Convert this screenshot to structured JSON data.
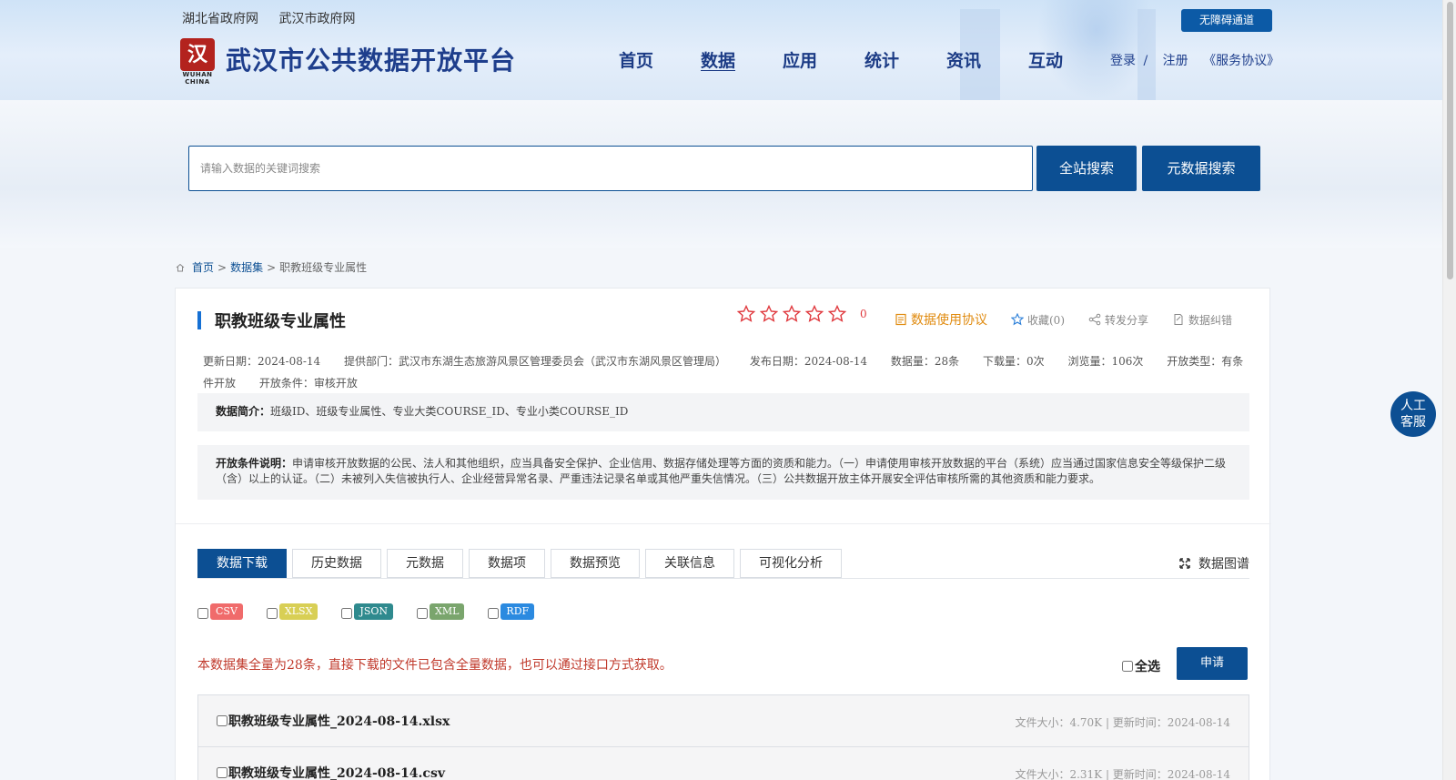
{
  "header": {
    "top_links": [
      "湖北省政府网",
      "武汉市政府网"
    ],
    "logo_text": "武汉市公共数据开放平台",
    "logo_seal": "汉",
    "logo_sub": "WUHAN CHINA",
    "nav": [
      "首页",
      "数据",
      "应用",
      "统计",
      "资讯",
      "互动"
    ],
    "nav_active_index": 1,
    "accessible_channel": "无障碍通道",
    "login": "登录",
    "login_sep": "/",
    "register": "注册",
    "service_agreement": "《服务协议》"
  },
  "search": {
    "placeholder": "请输入数据的关键词搜索",
    "site_search": "全站搜索",
    "metadata_search": "元数据搜索"
  },
  "breadcrumb": {
    "home": "首页",
    "sep": ">",
    "dataset": "数据集",
    "current": "职教班级专业属性"
  },
  "dataset": {
    "title": "职教班级专业属性",
    "rating_count": "0",
    "agreement": "数据使用协议",
    "favorite": "收藏(0)",
    "share": "转发分享",
    "correction": "数据纠错",
    "meta": {
      "update_date": "更新日期：2024-08-14",
      "provider": "提供部门：武汉市东湖生态旅游风景区管理委员会（武汉市东湖风景区管理局）",
      "publish_date": "发布日期：2024-08-14",
      "data_count": "数据量：28条",
      "downloads": "下载量：0次",
      "views": "浏览量：106次",
      "open_type": "开放类型：有条件开放",
      "open_condition": "开放条件：审核开放"
    },
    "summary_label": "数据简介：",
    "summary": "班级ID、班级专业属性、专业大类COURSE_ID、专业小类COURSE_ID",
    "condition_label": "开放条件说明：",
    "condition_text": "申请审核开放数据的公民、法人和其他组织，应当具备安全保护、企业信用、数据存储处理等方面的资质和能力。（一）申请使用审核开放数据的平台（系统）应当通过国家信息安全等级保护二级（含）以上的认证。（二）未被列入失信被执行人、企业经营异常名录、严重违法记录名单或其他严重失信情况。（三）公共数据开放主体开展安全评估审核所需的其他资质和能力要求。"
  },
  "tabs": [
    "数据下载",
    "历史数据",
    "元数据",
    "数据项",
    "数据预览",
    "关联信息",
    "可视化分析"
  ],
  "data_graph": "数据图谱",
  "formats": [
    {
      "label": "CSV",
      "color": "#f06b6b"
    },
    {
      "label": "XLSX",
      "color": "#d8cf55"
    },
    {
      "label": "JSON",
      "color": "#2f8a8e"
    },
    {
      "label": "XML",
      "color": "#7aa56d"
    },
    {
      "label": "RDF",
      "color": "#2b8ae0"
    }
  ],
  "notice": "本数据集全量为28条，直接下载的文件已包含全量数据，也可以通过接口方式获取。",
  "select_all": "全选",
  "apply": "申请",
  "files": [
    {
      "name": "职教班级专业属性_2024-08-14.xlsx",
      "info": "文件大小：4.70K | 更新时间：2024-08-14"
    },
    {
      "name": "职教班级专业属性_2024-08-14.csv",
      "info": "文件大小：2.31K | 更新时间：2024-08-14"
    }
  ],
  "service": {
    "line1": "人工",
    "line2": "客服"
  }
}
